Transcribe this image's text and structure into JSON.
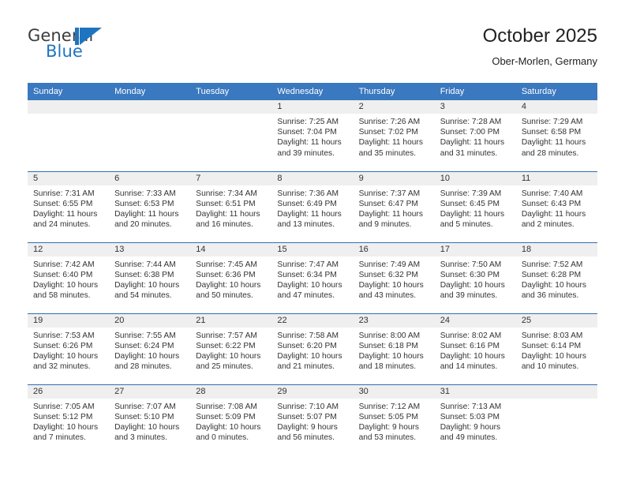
{
  "brand": {
    "name_top": "General",
    "name_bottom": "Blue",
    "mark": "triangle-logo",
    "color_text": "#3c3c3c",
    "color_accent": "#1f74c0"
  },
  "header": {
    "title": "October 2025",
    "subtitle": "Ober-Morlen, Germany"
  },
  "theme": {
    "header_blue": "#3a78bf",
    "row_divider": "#2f6fb5",
    "daynum_band": "#efefef",
    "text": "#333333"
  },
  "calendar": {
    "weekday_headers": [
      "Sunday",
      "Monday",
      "Tuesday",
      "Wednesday",
      "Thursday",
      "Friday",
      "Saturday"
    ],
    "weeks": [
      [
        {
          "day": "",
          "empty": true
        },
        {
          "day": "",
          "empty": true
        },
        {
          "day": "",
          "empty": true
        },
        {
          "day": "1",
          "sunrise": "Sunrise: 7:25 AM",
          "sunset": "Sunset: 7:04 PM",
          "daylight": "Daylight: 11 hours and 39 minutes."
        },
        {
          "day": "2",
          "sunrise": "Sunrise: 7:26 AM",
          "sunset": "Sunset: 7:02 PM",
          "daylight": "Daylight: 11 hours and 35 minutes."
        },
        {
          "day": "3",
          "sunrise": "Sunrise: 7:28 AM",
          "sunset": "Sunset: 7:00 PM",
          "daylight": "Daylight: 11 hours and 31 minutes."
        },
        {
          "day": "4",
          "sunrise": "Sunrise: 7:29 AM",
          "sunset": "Sunset: 6:58 PM",
          "daylight": "Daylight: 11 hours and 28 minutes."
        }
      ],
      [
        {
          "day": "5",
          "sunrise": "Sunrise: 7:31 AM",
          "sunset": "Sunset: 6:55 PM",
          "daylight": "Daylight: 11 hours and 24 minutes."
        },
        {
          "day": "6",
          "sunrise": "Sunrise: 7:33 AM",
          "sunset": "Sunset: 6:53 PM",
          "daylight": "Daylight: 11 hours and 20 minutes."
        },
        {
          "day": "7",
          "sunrise": "Sunrise: 7:34 AM",
          "sunset": "Sunset: 6:51 PM",
          "daylight": "Daylight: 11 hours and 16 minutes."
        },
        {
          "day": "8",
          "sunrise": "Sunrise: 7:36 AM",
          "sunset": "Sunset: 6:49 PM",
          "daylight": "Daylight: 11 hours and 13 minutes."
        },
        {
          "day": "9",
          "sunrise": "Sunrise: 7:37 AM",
          "sunset": "Sunset: 6:47 PM",
          "daylight": "Daylight: 11 hours and 9 minutes."
        },
        {
          "day": "10",
          "sunrise": "Sunrise: 7:39 AM",
          "sunset": "Sunset: 6:45 PM",
          "daylight": "Daylight: 11 hours and 5 minutes."
        },
        {
          "day": "11",
          "sunrise": "Sunrise: 7:40 AM",
          "sunset": "Sunset: 6:43 PM",
          "daylight": "Daylight: 11 hours and 2 minutes."
        }
      ],
      [
        {
          "day": "12",
          "sunrise": "Sunrise: 7:42 AM",
          "sunset": "Sunset: 6:40 PM",
          "daylight": "Daylight: 10 hours and 58 minutes."
        },
        {
          "day": "13",
          "sunrise": "Sunrise: 7:44 AM",
          "sunset": "Sunset: 6:38 PM",
          "daylight": "Daylight: 10 hours and 54 minutes."
        },
        {
          "day": "14",
          "sunrise": "Sunrise: 7:45 AM",
          "sunset": "Sunset: 6:36 PM",
          "daylight": "Daylight: 10 hours and 50 minutes."
        },
        {
          "day": "15",
          "sunrise": "Sunrise: 7:47 AM",
          "sunset": "Sunset: 6:34 PM",
          "daylight": "Daylight: 10 hours and 47 minutes."
        },
        {
          "day": "16",
          "sunrise": "Sunrise: 7:49 AM",
          "sunset": "Sunset: 6:32 PM",
          "daylight": "Daylight: 10 hours and 43 minutes."
        },
        {
          "day": "17",
          "sunrise": "Sunrise: 7:50 AM",
          "sunset": "Sunset: 6:30 PM",
          "daylight": "Daylight: 10 hours and 39 minutes."
        },
        {
          "day": "18",
          "sunrise": "Sunrise: 7:52 AM",
          "sunset": "Sunset: 6:28 PM",
          "daylight": "Daylight: 10 hours and 36 minutes."
        }
      ],
      [
        {
          "day": "19",
          "sunrise": "Sunrise: 7:53 AM",
          "sunset": "Sunset: 6:26 PM",
          "daylight": "Daylight: 10 hours and 32 minutes."
        },
        {
          "day": "20",
          "sunrise": "Sunrise: 7:55 AM",
          "sunset": "Sunset: 6:24 PM",
          "daylight": "Daylight: 10 hours and 28 minutes."
        },
        {
          "day": "21",
          "sunrise": "Sunrise: 7:57 AM",
          "sunset": "Sunset: 6:22 PM",
          "daylight": "Daylight: 10 hours and 25 minutes."
        },
        {
          "day": "22",
          "sunrise": "Sunrise: 7:58 AM",
          "sunset": "Sunset: 6:20 PM",
          "daylight": "Daylight: 10 hours and 21 minutes."
        },
        {
          "day": "23",
          "sunrise": "Sunrise: 8:00 AM",
          "sunset": "Sunset: 6:18 PM",
          "daylight": "Daylight: 10 hours and 18 minutes."
        },
        {
          "day": "24",
          "sunrise": "Sunrise: 8:02 AM",
          "sunset": "Sunset: 6:16 PM",
          "daylight": "Daylight: 10 hours and 14 minutes."
        },
        {
          "day": "25",
          "sunrise": "Sunrise: 8:03 AM",
          "sunset": "Sunset: 6:14 PM",
          "daylight": "Daylight: 10 hours and 10 minutes."
        }
      ],
      [
        {
          "day": "26",
          "sunrise": "Sunrise: 7:05 AM",
          "sunset": "Sunset: 5:12 PM",
          "daylight": "Daylight: 10 hours and 7 minutes."
        },
        {
          "day": "27",
          "sunrise": "Sunrise: 7:07 AM",
          "sunset": "Sunset: 5:10 PM",
          "daylight": "Daylight: 10 hours and 3 minutes."
        },
        {
          "day": "28",
          "sunrise": "Sunrise: 7:08 AM",
          "sunset": "Sunset: 5:09 PM",
          "daylight": "Daylight: 10 hours and 0 minutes."
        },
        {
          "day": "29",
          "sunrise": "Sunrise: 7:10 AM",
          "sunset": "Sunset: 5:07 PM",
          "daylight": "Daylight: 9 hours and 56 minutes."
        },
        {
          "day": "30",
          "sunrise": "Sunrise: 7:12 AM",
          "sunset": "Sunset: 5:05 PM",
          "daylight": "Daylight: 9 hours and 53 minutes."
        },
        {
          "day": "31",
          "sunrise": "Sunrise: 7:13 AM",
          "sunset": "Sunset: 5:03 PM",
          "daylight": "Daylight: 9 hours and 49 minutes."
        },
        {
          "day": "",
          "empty": true
        }
      ]
    ]
  }
}
